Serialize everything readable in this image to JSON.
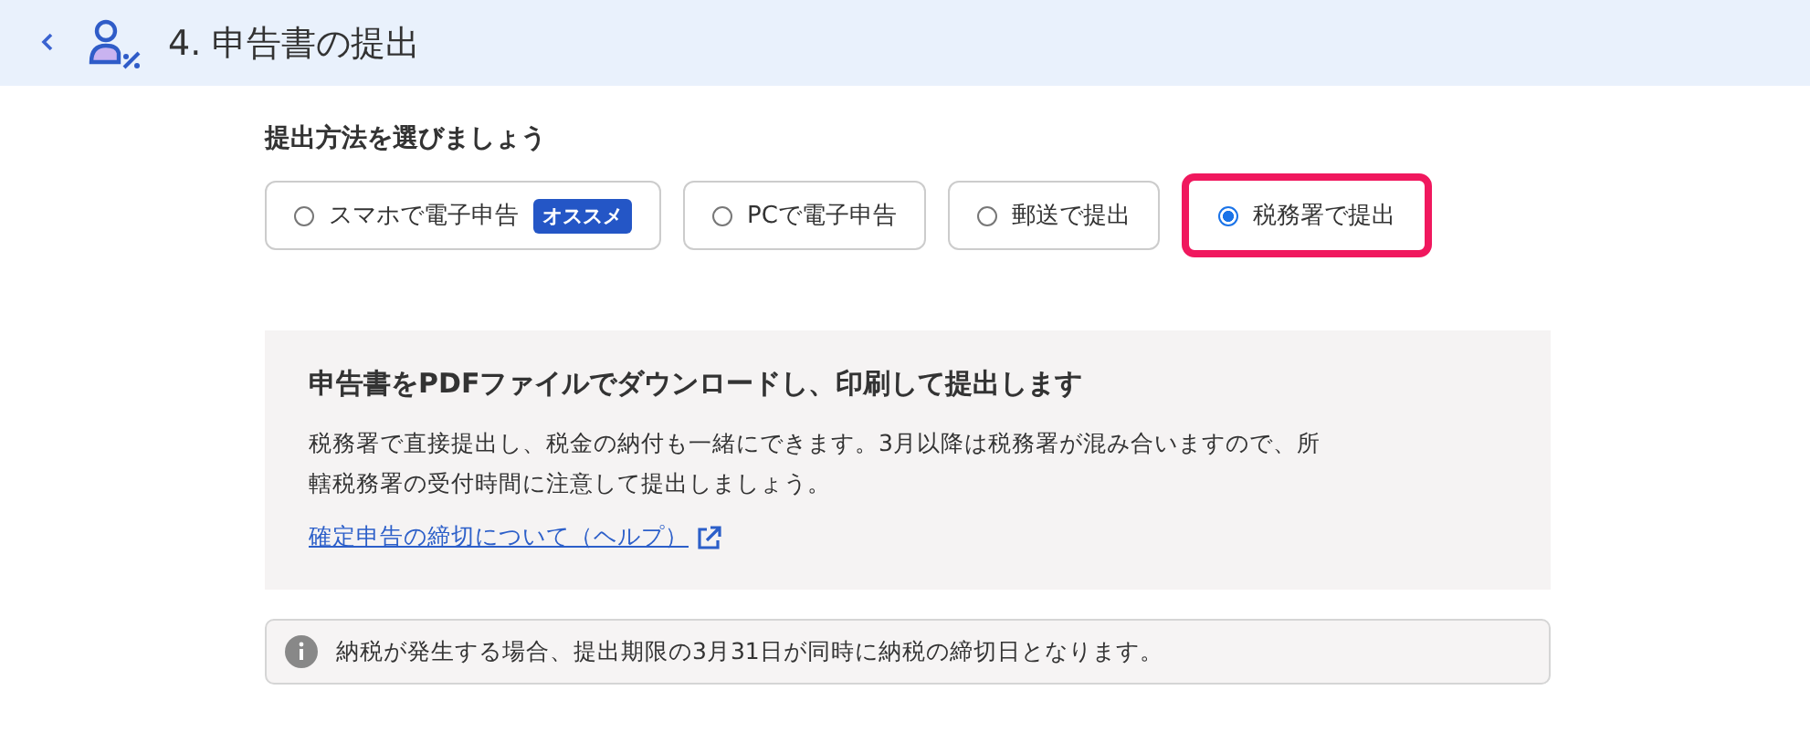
{
  "header": {
    "title": "4. 申告書の提出"
  },
  "section_title": "提出方法を選びましょう",
  "options": [
    {
      "label": "スマホで電子申告",
      "badge": "オススメ",
      "selected": false
    },
    {
      "label": "PCで電子申告",
      "selected": false
    },
    {
      "label": "郵送で提出",
      "selected": false
    },
    {
      "label": "税務署で提出",
      "selected": true
    }
  ],
  "panel": {
    "heading": "申告書をPDFファイルでダウンロードし、印刷して提出します",
    "body": "税務署で直接提出し、税金の納付も一緒にできます。3月以降は税務署が混み合いますので、所轄税務署の受付時間に注意して提出しましょう。",
    "link": "確定申告の締切について（ヘルプ）"
  },
  "notice": "納税が発生する場合、提出期限の3月31日が同時に納税の締切日となります。"
}
